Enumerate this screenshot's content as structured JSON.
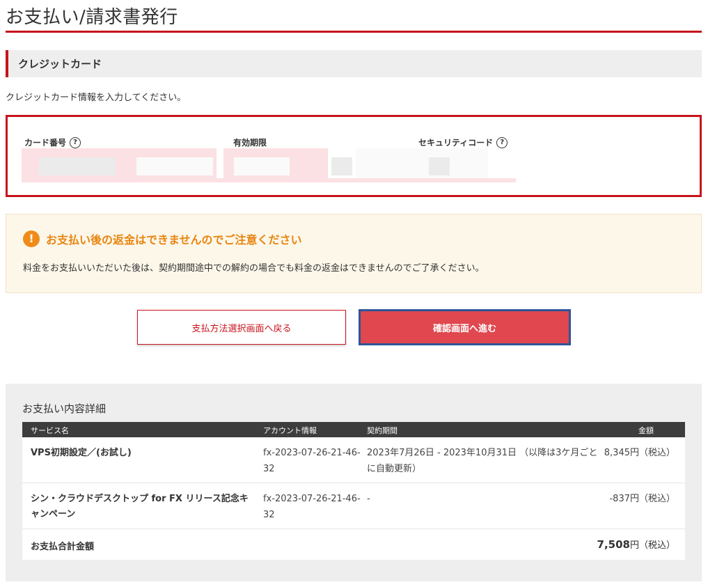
{
  "page": {
    "title": "お支払い/請求書発行"
  },
  "credit_card": {
    "heading": "クレジットカード",
    "intro": "クレジットカード情報を入力してください。",
    "card_number_label": "カード番号",
    "expiry_label": "有効期限",
    "security_code_label": "セキュリティコード",
    "help_glyph": "?"
  },
  "notice": {
    "icon_glyph": "!",
    "title": "お支払い後の返金はできませんのでご注意ください",
    "body": "料金をお支払いいただいた後は、契約期間途中での解約の場合でも料金の返金はできませんのでご了承ください。"
  },
  "buttons": {
    "back_label": "支払方法選択画面へ戻る",
    "next_label": "確認画面へ進む"
  },
  "details": {
    "title": "お支払い内容詳細",
    "columns": [
      "サービス名",
      "アカウント情報",
      "契約期間",
      "金額"
    ],
    "rows": [
      {
        "service": "VPS初期設定／(お試し)",
        "account": "fx-2023-07-26-21-46-32",
        "period": "2023年7月26日 - 2023年10月31日 （以降は3ケ月ごとに自動更新）",
        "amount": "8,345円（税込）"
      },
      {
        "service": "シン・クラウドデスクトップ for FX リリース記念キャンペーン",
        "account": "fx-2023-07-26-21-46-32",
        "period": "-",
        "amount": "-837円（税込）"
      }
    ],
    "total_label": "お支払合計金額",
    "total_value": "7,508",
    "total_suffix": "円（税込）"
  },
  "colors": {
    "accent_red": "#c7131b",
    "button_red": "#e0474f",
    "focus_blue": "#2e5597",
    "warning_orange": "#f08b1a",
    "notice_bg": "#fdf7ea",
    "table_header": "#3d3d3d"
  },
  "icons": {
    "help": "question-circle-icon",
    "warning": "exclamation-circle-icon"
  }
}
